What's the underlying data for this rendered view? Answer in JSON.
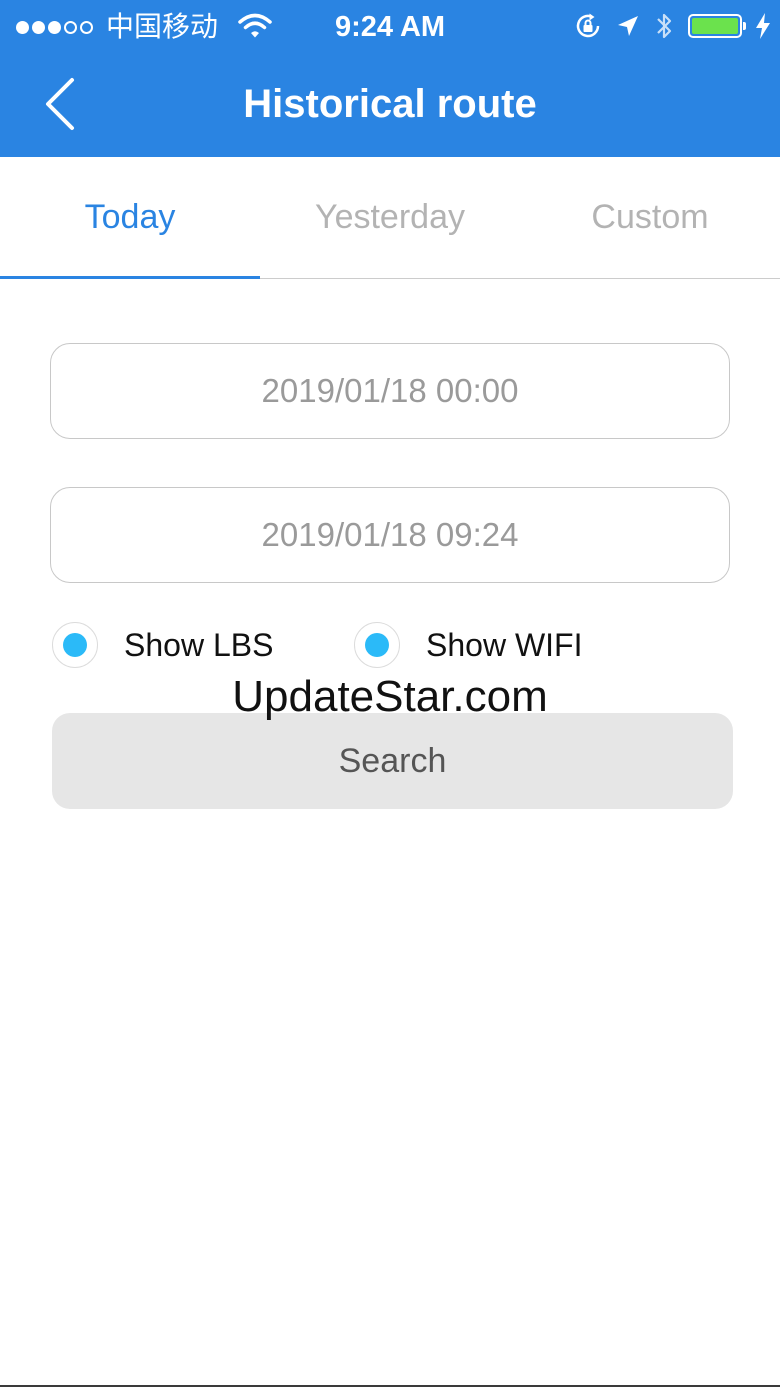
{
  "status_bar": {
    "signal_icon": "signal-dots-icon",
    "signal_bars_filled": 3,
    "signal_bars_total": 5,
    "carrier": "中国移动",
    "time": "9:24 AM",
    "battery_level": 1.0
  },
  "nav": {
    "back_icon": "chevron-left-icon",
    "title": "Historical route"
  },
  "tabs": [
    {
      "label": "Today",
      "active": true
    },
    {
      "label": "Yesterday",
      "active": false
    },
    {
      "label": "Custom",
      "active": false
    }
  ],
  "form": {
    "start_time": "2019/01/18 00:00",
    "end_time": "2019/01/18 09:24",
    "options": [
      {
        "label": "Show LBS",
        "selected": true
      },
      {
        "label": "Show WIFI",
        "selected": true
      }
    ],
    "search_label": "Search"
  },
  "watermark": "UpdateStar.com",
  "colors": {
    "accent": "#2a84e2",
    "radio": "#2bbaf8",
    "battery": "#6be24d"
  }
}
